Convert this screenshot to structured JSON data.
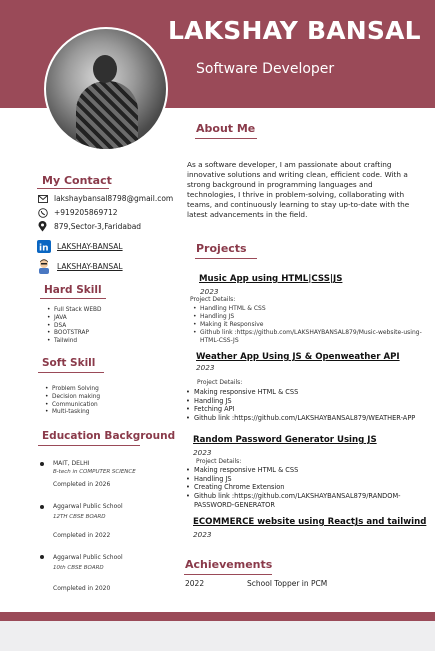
{
  "header": {
    "name": "LAKSHAY BANSAL",
    "role": "Software Developer"
  },
  "contact": {
    "heading": "My Contact",
    "email": "lakshaybansal8798@gmail.com",
    "phone": "+919205869712",
    "address": "879,Sector-3,Faridabad",
    "linkedin": "LAKSHAY-BANSAL",
    "github": "LAKSHAY-BANSAL"
  },
  "hard_skill": {
    "heading": "Hard Skill",
    "items": [
      "Full Stack WEBD",
      "JAVA",
      "DSA",
      "BOOTSTRAP",
      "Tailwind"
    ]
  },
  "soft_skill": {
    "heading": "Soft Skill",
    "items": [
      "Problem Solving",
      "Decision making",
      "Communication",
      "Multi-tasking"
    ]
  },
  "education": {
    "heading": "Education Background",
    "entries": [
      {
        "school": "MAIT, DELHI",
        "detail": "B-tech in COMPUTER SCIENCE",
        "status": "Completed in 2026"
      },
      {
        "school": "Aggarwal Public School",
        "detail": "12TH CBSE BOARD",
        "status": "Completed in 2022"
      },
      {
        "school": "Aggarwal Public School",
        "detail": "10th CBSE BOARD",
        "status": "Completed in 2020"
      }
    ]
  },
  "about": {
    "heading": "About Me",
    "text": "As a software developer, I am passionate about crafting innovative solutions and writing clean, efficient code. With a strong background in programming languages and technologies, I thrive in problem-solving, collaborating with teams, and continuously learning to stay up-to-date with the latest advancements in the field."
  },
  "projects": {
    "heading": "Projects",
    "items": [
      {
        "title": "Music App using HTML|CSS|JS",
        "year": "2023",
        "details_label": "Project Details:",
        "points": [
          "Handling HTML & CSS",
          "Handling JS",
          "Making it Responsive",
          "Github link :https://github.com/LAKSHAYBANSAL879/Music-website-using-HTML-CSS-JS"
        ]
      },
      {
        "title": "Weather App  Using JS & Openweather API",
        "year": "2023",
        "details_label": "Project Details:",
        "points": [
          "Making responsive  HTML & CSS",
          "Handling JS",
          "Fetching API",
          "Github link :https://github.com/LAKSHAYBANSAL879/WEATHER-APP"
        ]
      },
      {
        "title": "Random Password Generator  Using JS",
        "year": "2023",
        "details_label": "Project Details:",
        "points": [
          "Making responsive  HTML & CSS",
          "Handling JS",
          "Creating Chrome Extension",
          "Github link :https://github.com/LAKSHAYBANSAL879/RANDOM-PASSWORD-GENERATOR"
        ]
      },
      {
        "title": "ECOMMERCE website using ReactJs and tailwind",
        "year": "2023"
      }
    ]
  },
  "achievements": {
    "heading": "Achievements",
    "year": "2022",
    "text": "School Topper in PCM"
  },
  "colors": {
    "accent": "#9a4a58",
    "heading": "#8a3a4a"
  }
}
